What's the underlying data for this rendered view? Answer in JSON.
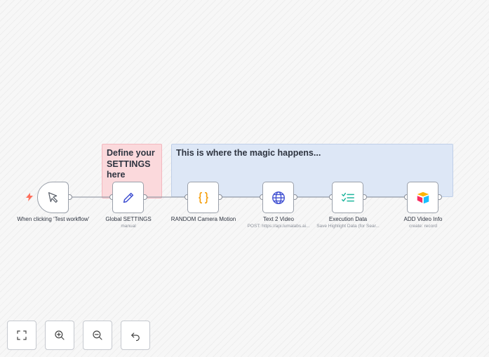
{
  "canvas": {
    "sticky_notes": [
      {
        "text": "Define your SETTINGS here",
        "color": "#fbd9dc"
      },
      {
        "text": "This is where the magic happens...",
        "color": "#dde7f6"
      }
    ]
  },
  "nodes": [
    {
      "name": "When clicking ‘Test workflow’",
      "subtitle": "",
      "icon": "cursor-icon",
      "type": "trigger"
    },
    {
      "name": "Global SETTINGS",
      "subtitle": "manual",
      "icon": "pencil-icon"
    },
    {
      "name": "RANDOM Camera Motion",
      "subtitle": "",
      "icon": "code-braces-icon"
    },
    {
      "name": "Text 2 Video",
      "subtitle": "POST: https://api.lumalabs.ai...",
      "icon": "globe-icon"
    },
    {
      "name": "Execution Data",
      "subtitle": "Save Highlight Data (for Sear...",
      "icon": "checklist-icon"
    },
    {
      "name": "ADD Video Info",
      "subtitle": "create: record",
      "icon": "airtable-icon"
    }
  ],
  "controls": [
    {
      "name": "fit-view",
      "icon": "fit-screen-icon"
    },
    {
      "name": "zoom-in",
      "icon": "zoom-in-icon"
    },
    {
      "name": "zoom-out",
      "icon": "zoom-out-icon"
    },
    {
      "name": "reset-zoom",
      "icon": "undo-icon"
    }
  ],
  "colors": {
    "trigger_bolt": "#ff6d5a",
    "pencil": "#3f4fd1",
    "code": "#f59e0b",
    "globe": "#3f4fd1",
    "checklist": "#20b69e"
  }
}
